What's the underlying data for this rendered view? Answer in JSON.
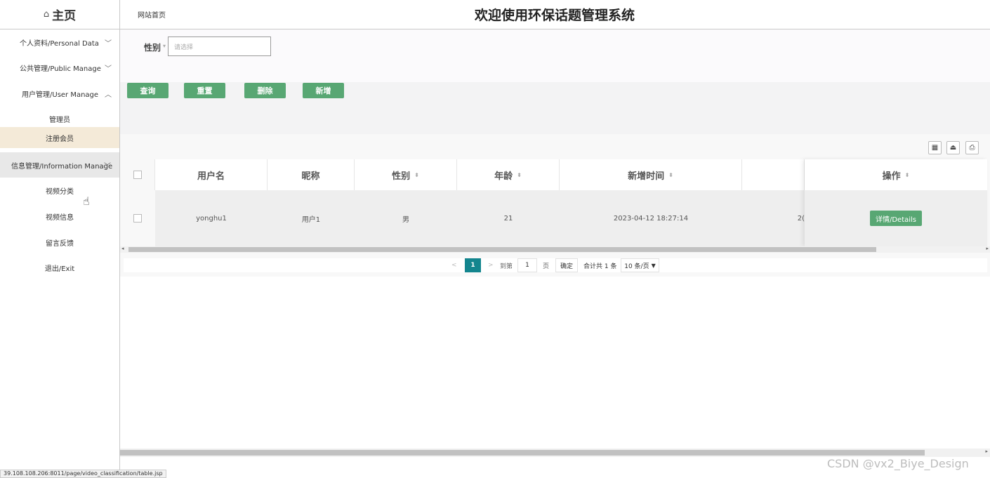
{
  "header": {
    "home_icon": "home-icon",
    "brand": "主页",
    "site_link": "网站首页",
    "title": "欢迎使用环保话题管理系统"
  },
  "sidebar": {
    "groups": [
      {
        "label": "个人资料/Personal Data",
        "chev": "﹀"
      },
      {
        "label": "公共管理/Public Manage",
        "chev": "﹀"
      },
      {
        "label": "用户管理/User Manage",
        "chev": "︿"
      },
      {
        "label": "信息管理/Information Manage",
        "chev": "﹀"
      }
    ],
    "sub_items": [
      "管理员",
      "注册会员",
      "视频分类",
      "视频信息",
      "留言反馈",
      "退出/Exit"
    ]
  },
  "filter": {
    "label": "性别",
    "placeholder": "请选择"
  },
  "buttons": {
    "query": "查询",
    "reset": "重置",
    "delete": "删除",
    "add": "新增"
  },
  "table": {
    "columns": [
      "用户名",
      "昵称",
      "性别",
      "年龄",
      "新增时间",
      "操作"
    ],
    "sort_icon": "⬍",
    "action_label": "详情/Details"
  },
  "chart_data": {
    "type": "table",
    "columns": [
      "用户名",
      "昵称",
      "性别",
      "年龄",
      "新增时间"
    ],
    "rows": [
      [
        "yonghu1",
        "用户1",
        "男",
        "21",
        "2023-04-12 18:27:14"
      ]
    ]
  },
  "hidden_col_fragment": "2(",
  "pager": {
    "prev": "<",
    "current": "1",
    "next": ">",
    "goto_label": "到第",
    "goto_value": "1",
    "page_unit": "页",
    "confirm": "确定",
    "total": "合计共 1 条",
    "page_size": "10 条/页"
  },
  "status_url": "39.108.108.206:8011/page/video_classification/table.jsp",
  "watermark": "CSDN @vx2_Biye_Design"
}
